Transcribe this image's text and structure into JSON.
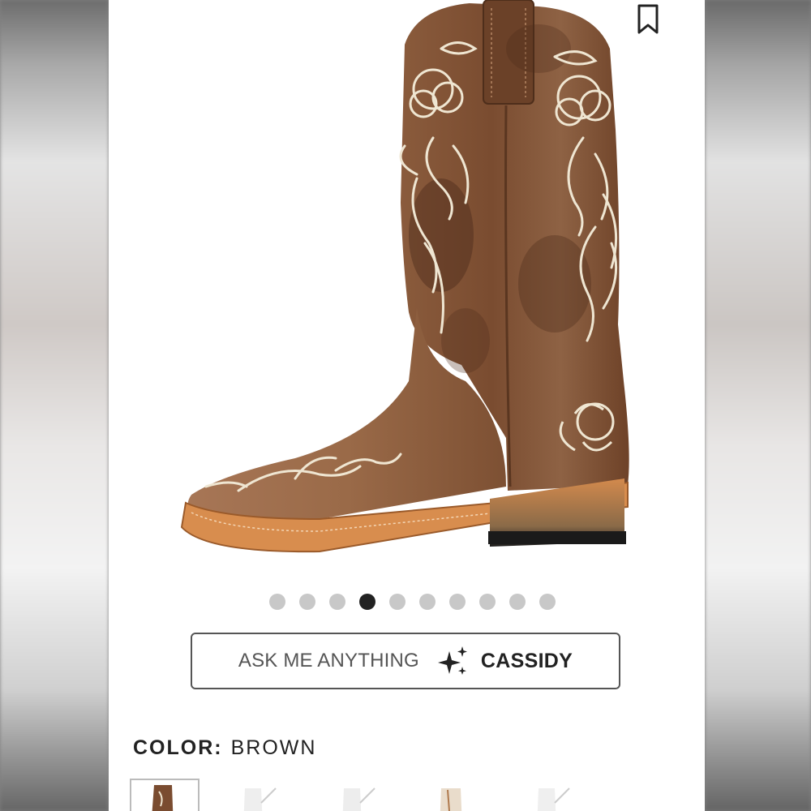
{
  "product": {
    "image_alt": "Brown embroidered western boot",
    "colors": {
      "leather": "#8a5a3a",
      "embroidery": "#efe6d2",
      "sole": "#d88d4e"
    }
  },
  "carousel": {
    "total": 10,
    "active_index": 3
  },
  "assistant": {
    "prompt_label": "ASK ME ANYTHING",
    "name_label": "CASSIDY",
    "icon": "sparkle-icon"
  },
  "color_selector": {
    "label": "COLOR:",
    "value": "BROWN",
    "swatches": [
      "brown",
      "white",
      "white",
      "tan",
      "white"
    ],
    "selected_index": 0
  },
  "icons": {
    "bookmark": "bookmark-icon"
  }
}
